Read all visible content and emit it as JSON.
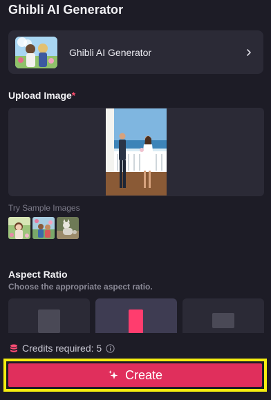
{
  "page": {
    "title": "Ghibli AI Generator"
  },
  "model": {
    "name": "Ghibli AI Generator"
  },
  "upload": {
    "label": "Upload Image",
    "required_mark": "*"
  },
  "samples": {
    "label": "Try Sample Images"
  },
  "aspect": {
    "title": "Aspect Ratio",
    "subtitle": "Choose the appropriate aspect ratio.",
    "selected_index": 1
  },
  "credits": {
    "text": "Credits required: 5"
  },
  "actions": {
    "create_label": "Create"
  },
  "colors": {
    "accent": "#e02f5c",
    "highlight": "#f5ee10",
    "panel": "#2b2a36",
    "background": "#1d1c26"
  },
  "icons": [
    "chevron-right-icon",
    "database-icon",
    "info-icon",
    "sparkle-icon"
  ]
}
